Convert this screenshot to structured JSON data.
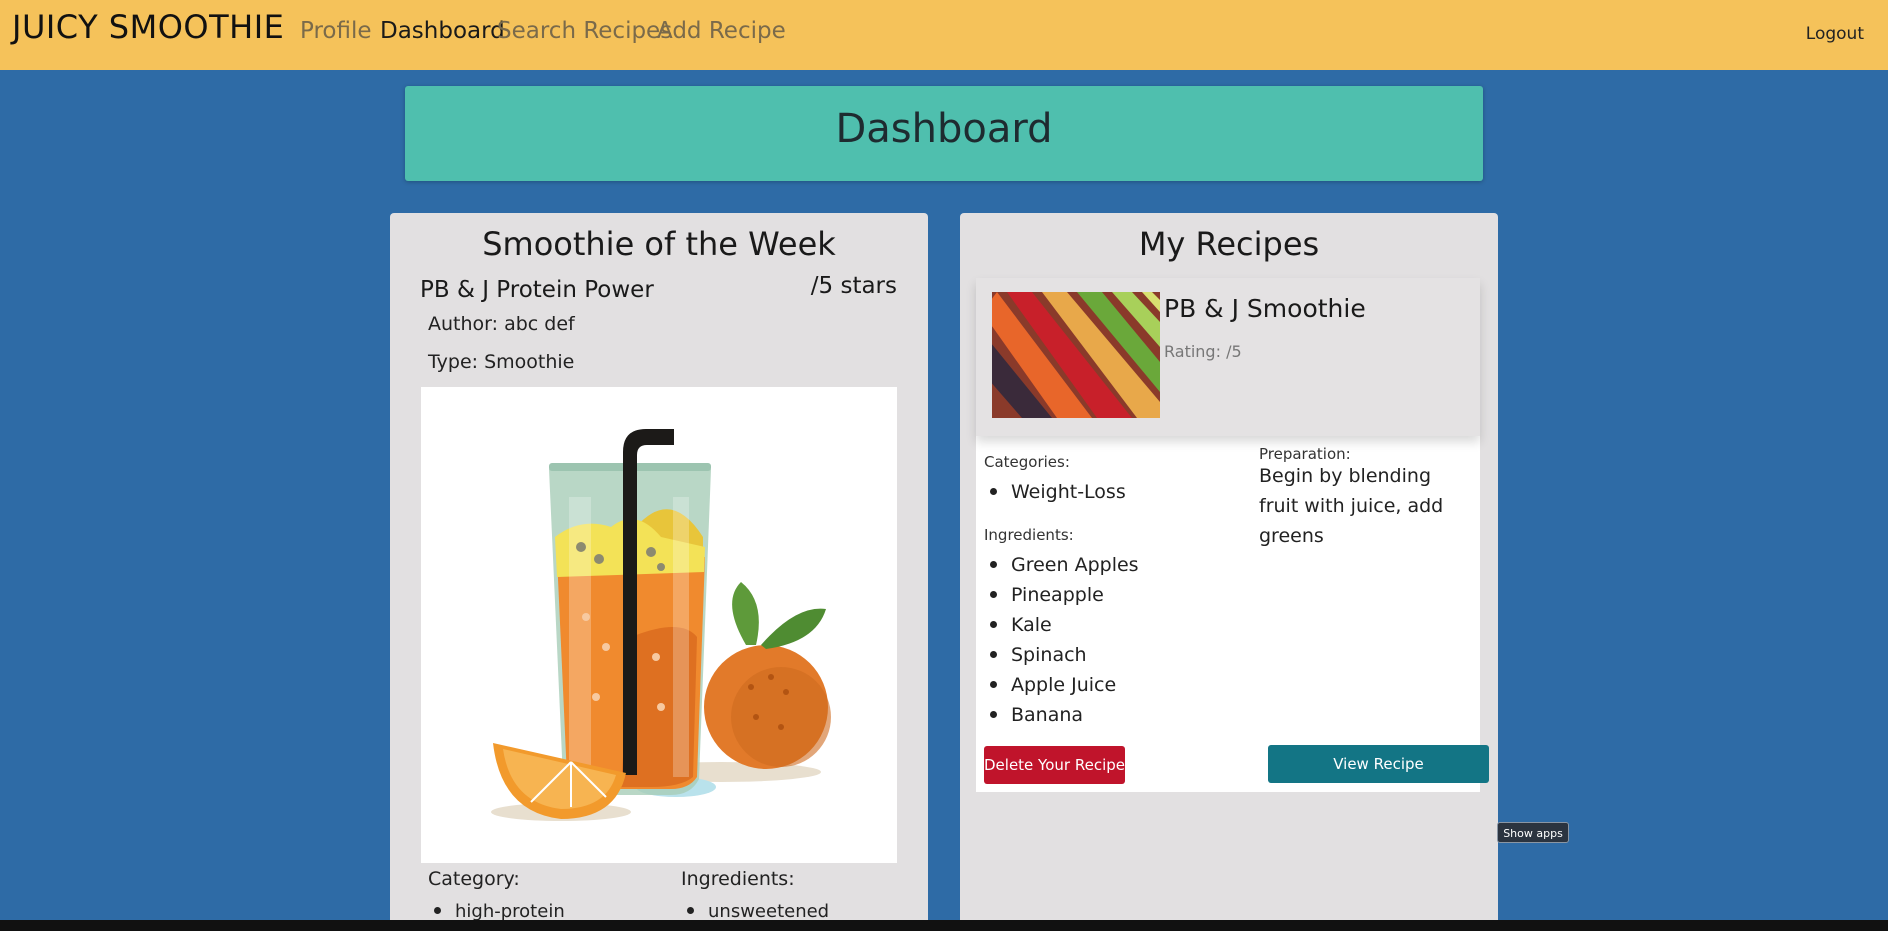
{
  "navbar": {
    "brand": "JUICY SMOOTHIE",
    "links": [
      "Profile",
      "Dashboard",
      "Search Recipes",
      "Add Recipe"
    ],
    "active": "Dashboard",
    "logout": "Logout"
  },
  "dashboard": {
    "title": "Dashboard"
  },
  "smoothie_of_week": {
    "heading": "Smoothie of the Week",
    "name": "PB & J Protein Power",
    "stars": "/5 stars",
    "author": "Author: abc def",
    "type": "Type: Smoothie",
    "image_icon": "smoothie-glass-orange-illustration",
    "category_label": "Category:",
    "categories": [
      "high-protein"
    ],
    "ingredients_label": "Ingredients:",
    "ingredients": [
      "unsweetened"
    ]
  },
  "my_recipes": {
    "heading": "My Recipes",
    "recipe": {
      "name": "PB & J Smoothie",
      "rating": "Rating: /5",
      "image_icon": "vegetables-photo",
      "categories_label": "Categories:",
      "categories": [
        "Weight-Loss"
      ],
      "ingredients_label": "Ingredients:",
      "ingredients": [
        "Green Apples",
        "Pineapple",
        "Kale",
        "Spinach",
        "Apple Juice",
        "Banana"
      ],
      "preparation_label": "Preparation:",
      "preparation": "Begin by blending fruit with juice, add greens",
      "delete_label": "Delete Your Recipe",
      "view_label": "View Recipe"
    }
  },
  "system": {
    "show_apps": "Show apps"
  },
  "colors": {
    "navbar": "#f5c25a",
    "background": "#2e6ba6",
    "banner": "#4fbfae",
    "panel": "#e2e0e1",
    "delete": "#c0142b",
    "view": "#137585"
  }
}
